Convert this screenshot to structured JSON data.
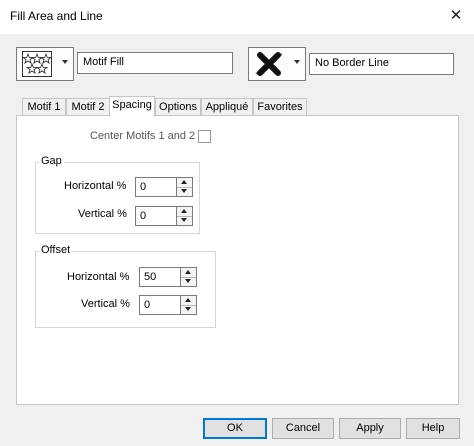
{
  "window": {
    "title": "Fill Area and Line"
  },
  "toolbar": {
    "fill_icon": "motif-fill-icon",
    "fill_name": "Motif Fill",
    "border_icon": "no-border-line-icon",
    "border_name": "No Border Line"
  },
  "tabs": [
    {
      "label": "Motif 1"
    },
    {
      "label": "Motif 2"
    },
    {
      "label": "Spacing",
      "active": true
    },
    {
      "label": "Options"
    },
    {
      "label": "Appliqué"
    },
    {
      "label": "Favorites"
    }
  ],
  "spacing": {
    "center_label": "Center Motifs 1 and 2",
    "center_checked": false,
    "gap": {
      "title": "Gap",
      "horizontal_label": "Horizontal %",
      "horizontal_value": "0",
      "vertical_label": "Vertical %",
      "vertical_value": "0"
    },
    "offset": {
      "title": "Offset",
      "horizontal_label": "Horizontal %",
      "horizontal_value": "50",
      "vertical_label": "Vertical %",
      "vertical_value": "0"
    }
  },
  "buttons": {
    "ok": "OK",
    "cancel": "Cancel",
    "apply": "Apply",
    "help": "Help"
  },
  "colors": {
    "accent": "#0078d7",
    "panel": "#ffffff",
    "dialog": "#f0f0f0"
  }
}
